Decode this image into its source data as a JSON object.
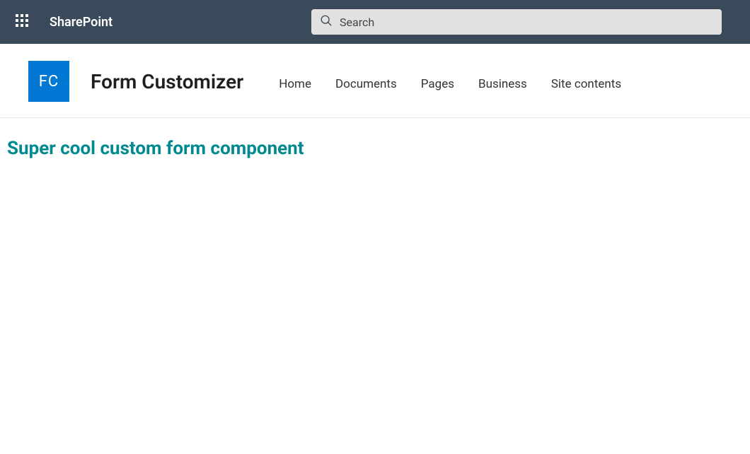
{
  "suite": {
    "app_name": "SharePoint"
  },
  "search": {
    "placeholder": "Search",
    "value": ""
  },
  "site": {
    "logo_initials": "FC",
    "title": "Form Customizer",
    "nav": [
      {
        "label": "Home"
      },
      {
        "label": "Documents"
      },
      {
        "label": "Pages"
      },
      {
        "label": "Business"
      },
      {
        "label": "Site contents"
      }
    ]
  },
  "main": {
    "heading": "Super cool custom form component"
  }
}
